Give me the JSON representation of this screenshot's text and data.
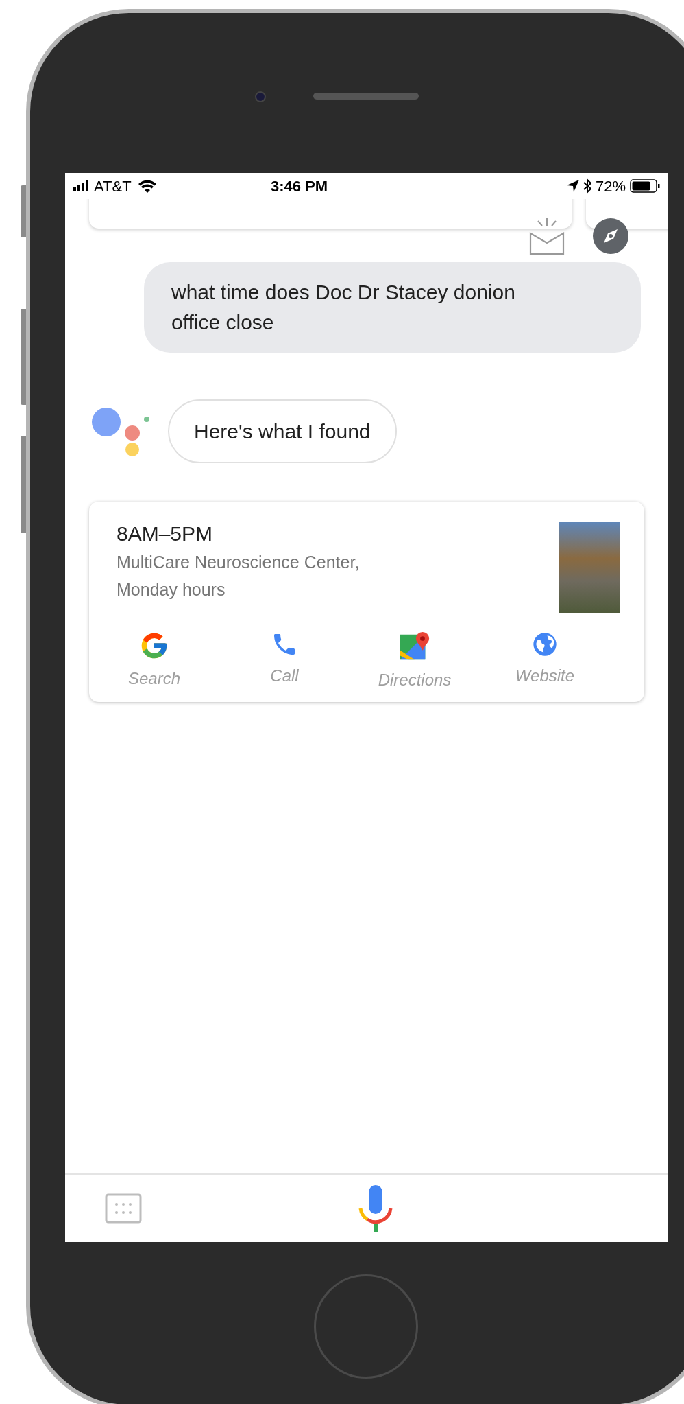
{
  "status_bar": {
    "carrier": "AT&T",
    "time": "3:46 PM",
    "battery": "72%"
  },
  "query": {
    "text": "what time does Doc Dr Stacey donion office close"
  },
  "assistant": {
    "reply": "Here's what I found"
  },
  "result": {
    "title": "8AM–5PM",
    "subtitle": "MultiCare Neuroscience Center, Monday hours",
    "actions": [
      {
        "kind": "search",
        "label": "Search"
      },
      {
        "kind": "call",
        "label": "Call"
      },
      {
        "kind": "directions",
        "label": "Directions"
      },
      {
        "kind": "website",
        "label": "Website"
      }
    ]
  }
}
